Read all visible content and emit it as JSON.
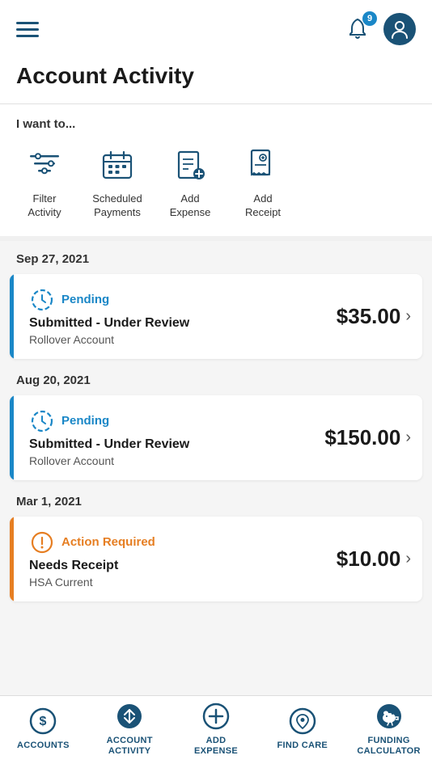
{
  "header": {
    "notification_count": "9",
    "hamburger_label": "Menu"
  },
  "page_title": "Account Activity",
  "i_want_to": {
    "label": "I want to...",
    "actions": [
      {
        "id": "filter-activity",
        "label": "Filter\nActivity",
        "icon": "filter"
      },
      {
        "id": "scheduled-payments",
        "label": "Scheduled\nPayments",
        "icon": "calendar"
      },
      {
        "id": "add-expense",
        "label": "Add\nExpense",
        "icon": "receipt-add"
      },
      {
        "id": "add-receipt",
        "label": "Add\nReceipt",
        "icon": "receipt"
      }
    ]
  },
  "activity": [
    {
      "date": "Sep 27, 2021",
      "status": "Pending",
      "status_type": "pending",
      "title": "Submitted - Under Review",
      "subtitle": "Rollover Account",
      "amount": "$35.00"
    },
    {
      "date": "Aug 20, 2021",
      "status": "Pending",
      "status_type": "pending",
      "title": "Submitted - Under Review",
      "subtitle": "Rollover Account",
      "amount": "$150.00"
    },
    {
      "date": "Mar 1, 2021",
      "status": "Action Required",
      "status_type": "action",
      "title": "Needs Receipt",
      "subtitle": "HSA Current",
      "amount": "$10.00"
    }
  ],
  "bottom_nav": [
    {
      "id": "accounts",
      "label": "ACCOUNTS",
      "icon": "dollar"
    },
    {
      "id": "account-activity",
      "label": "ACCOUNT\nACTIVITY",
      "icon": "transfer",
      "active": true
    },
    {
      "id": "add-expense",
      "label": "ADD\nEXPENSE",
      "icon": "plus-circle"
    },
    {
      "id": "find-care",
      "label": "FIND CARE",
      "icon": "location"
    },
    {
      "id": "funding-calculator",
      "label": "FUNDING\nCALCULATOR",
      "icon": "piggy"
    }
  ]
}
